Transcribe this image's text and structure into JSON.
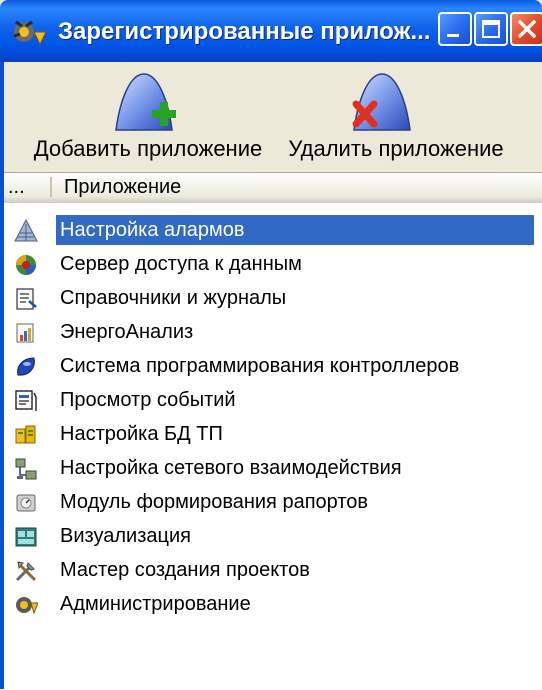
{
  "window": {
    "title": "Зарегистрированные прилож...",
    "title_icon": "gear-app-icon",
    "controls": [
      "minimize",
      "maximize",
      "close"
    ]
  },
  "toolbar": {
    "add_label": "Добавить приложение",
    "add_icon": "app-add-icon",
    "remove_label": "Удалить приложение",
    "remove_icon": "app-remove-icon"
  },
  "list": {
    "columns": [
      "...",
      "Приложение"
    ],
    "selected_index": 0,
    "items": [
      {
        "label": "Настройка алармов",
        "icon": "alarm-settings-icon"
      },
      {
        "label": "Сервер доступа к данным",
        "icon": "data-server-icon"
      },
      {
        "label": "Справочники и журналы",
        "icon": "journal-icon"
      },
      {
        "label": "ЭнергоАнализ",
        "icon": "energy-analysis-icon"
      },
      {
        "label": "Система программирования контроллеров",
        "icon": "controller-programming-icon"
      },
      {
        "label": "Просмотр событий",
        "icon": "event-viewer-icon"
      },
      {
        "label": "Настройка БД ТП",
        "icon": "database-settings-icon"
      },
      {
        "label": "Настройка сетевого взаимодействия",
        "icon": "network-settings-icon"
      },
      {
        "label": "Модуль формирования рапортов",
        "icon": "report-module-icon"
      },
      {
        "label": "Визуализация",
        "icon": "visualization-icon"
      },
      {
        "label": "Мастер создания проектов",
        "icon": "project-wizard-icon"
      },
      {
        "label": "Администрирование",
        "icon": "administration-icon"
      }
    ]
  },
  "colors": {
    "titlebar": "#0054e3",
    "selection": "#316ac5",
    "face": "#ece9d8"
  }
}
